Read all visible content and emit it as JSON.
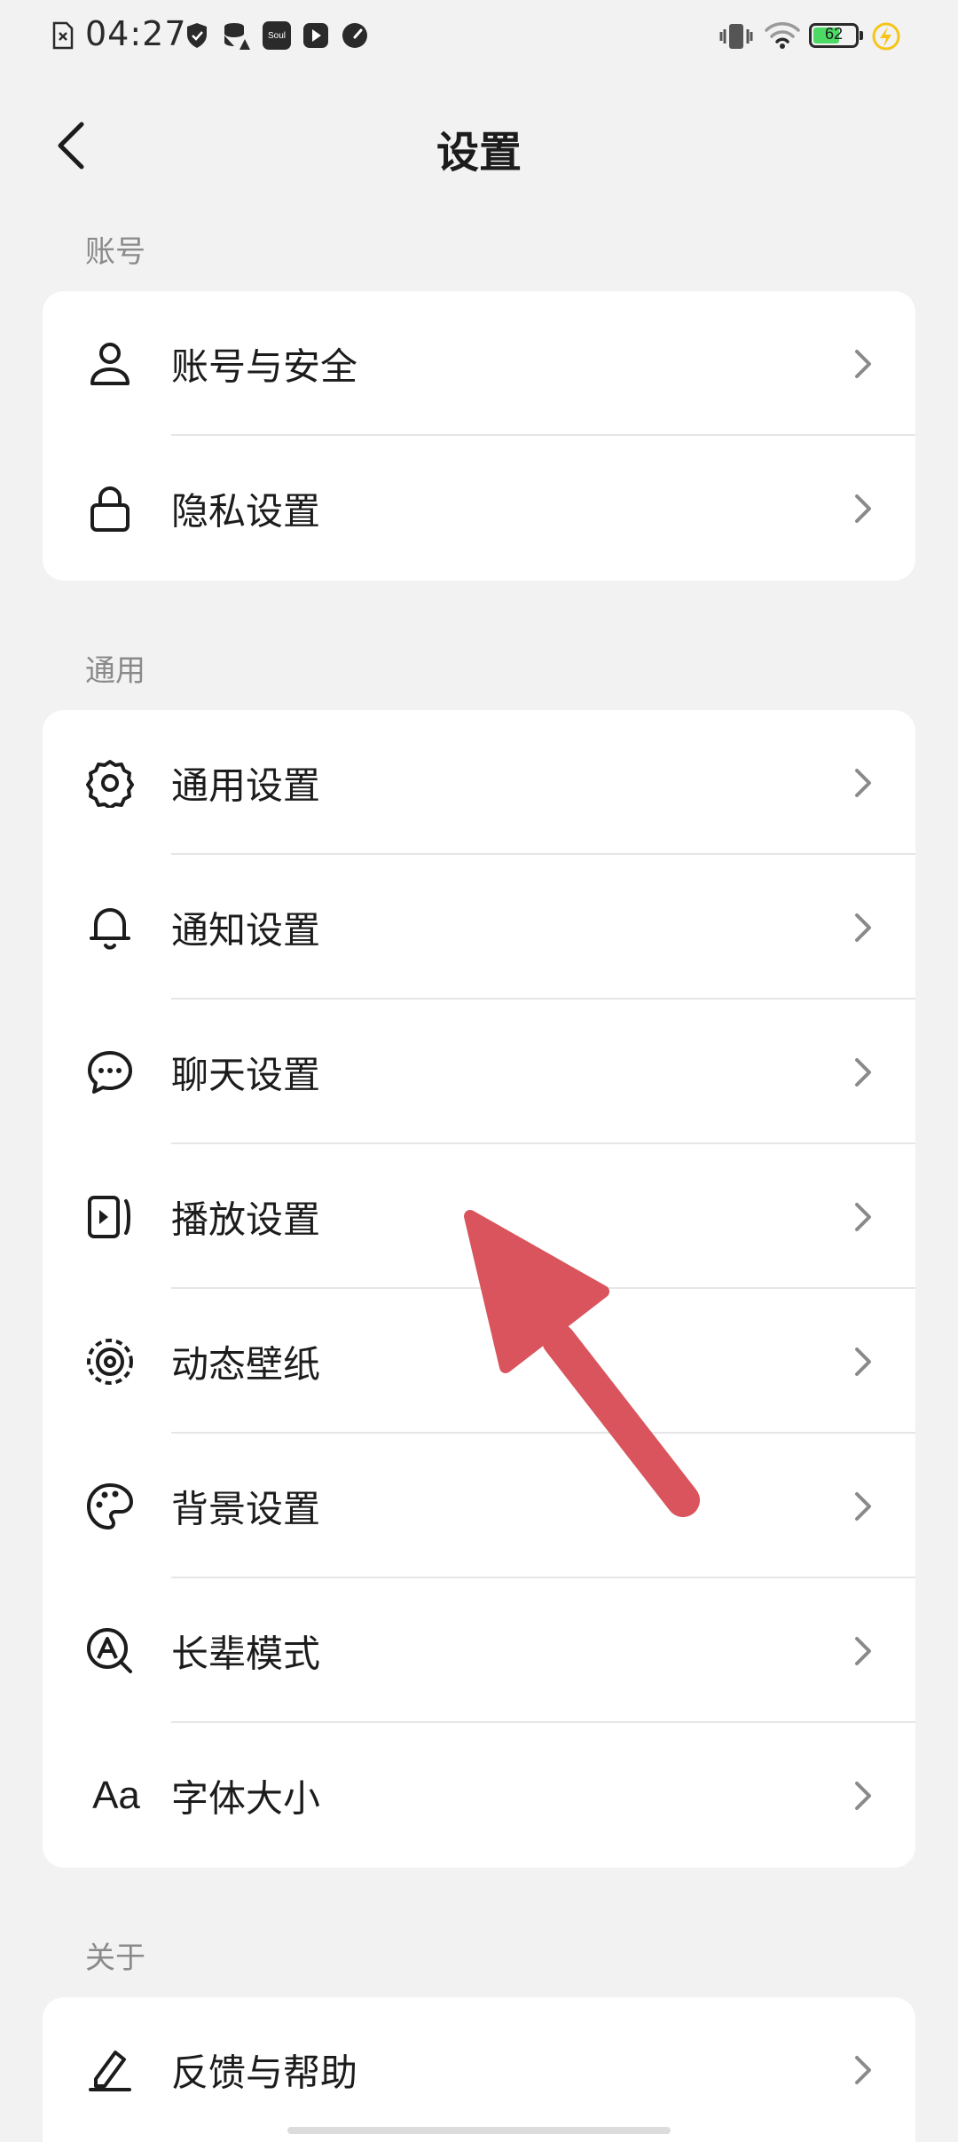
{
  "status_bar": {
    "time": "04:27",
    "battery": "62",
    "icons": [
      "sim-error-icon",
      "shield-icon",
      "data-saver-icon",
      "soul-app-icon",
      "video-icon",
      "speed-icon",
      "vibrate-icon",
      "wifi-icon",
      "battery-icon",
      "charging-icon"
    ],
    "soul_label": "Soul",
    "battery_color": "#4cd964",
    "charging_color": "#f5c518"
  },
  "header": {
    "title": "设置"
  },
  "sections": [
    {
      "label": "账号",
      "items": [
        {
          "label": "账号与安全",
          "icon": "user-icon"
        },
        {
          "label": "隐私设置",
          "icon": "lock-icon"
        }
      ]
    },
    {
      "label": "通用",
      "items": [
        {
          "label": "通用设置",
          "icon": "gear-icon"
        },
        {
          "label": "通知设置",
          "icon": "bell-icon"
        },
        {
          "label": "聊天设置",
          "icon": "chat-icon"
        },
        {
          "label": "播放设置",
          "icon": "play-icon"
        },
        {
          "label": "动态壁纸",
          "icon": "live-wallpaper-icon"
        },
        {
          "label": "背景设置",
          "icon": "palette-icon"
        },
        {
          "label": "长辈模式",
          "icon": "elder-mode-icon"
        },
        {
          "label": "字体大小",
          "icon": "font-size-icon",
          "icon_text": "Aa"
        }
      ]
    },
    {
      "label": "关于",
      "items": [
        {
          "label": "反馈与帮助",
          "icon": "edit-icon"
        }
      ]
    }
  ],
  "colors": {
    "background": "#f2f2f2",
    "card": "#ffffff",
    "arrow": "#d9545c",
    "chevron": "#8a8a8a"
  }
}
